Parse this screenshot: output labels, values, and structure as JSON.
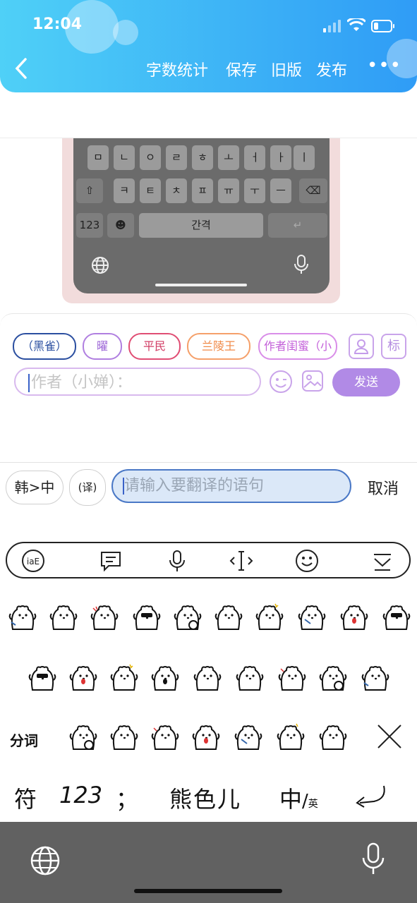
{
  "status_bar": {
    "time": "12:04"
  },
  "header": {
    "nav": [
      "字数统计",
      "保存",
      "旧版",
      "发布"
    ],
    "more": "•••"
  },
  "keyboard_image": {
    "row1": [
      "ㅁ",
      "ㄴ",
      "ㅇ",
      "ㄹ",
      "ㅎ",
      "ㅗ",
      "ㅓ",
      "ㅏ",
      "ㅣ"
    ],
    "row2": [
      "ㅋ",
      "ㅌ",
      "ㅊ",
      "ㅍ",
      "ㅠ",
      "ㅜ",
      "ㅡ"
    ],
    "shift_label": "⇧",
    "num_label": "123",
    "space_label": "간격",
    "return_label": "↵"
  },
  "chat": {
    "chips": [
      "（黑雀）",
      "曜",
      "平民",
      "兰陵王",
      "作者闺蜜（小"
    ],
    "badge_label": "标",
    "input_placeholder": "作者（小婵）：",
    "send_label": "发送"
  },
  "translate": {
    "lang_label": "韩>中",
    "mode_label": "(译)",
    "placeholder": "请输入要翻译的语句",
    "cancel_label": "取消"
  },
  "toolbar": {
    "icons": [
      "ime-logo-icon",
      "message-icon",
      "microphone-icon",
      "text-cursor-icon",
      "emoji-icon",
      "collapse-icon"
    ]
  },
  "stickers": {
    "side_label": "分词"
  },
  "bottom_row": {
    "fu": "符",
    "num": "123",
    "punct": "；",
    "name": "熊色儿",
    "zhong": "中",
    "ying": "英"
  },
  "colors": {
    "header_start": "#4fd0f7",
    "header_end": "#2f9cf6",
    "send_button": "#b18ae6",
    "translate_border": "#4a78c6"
  }
}
